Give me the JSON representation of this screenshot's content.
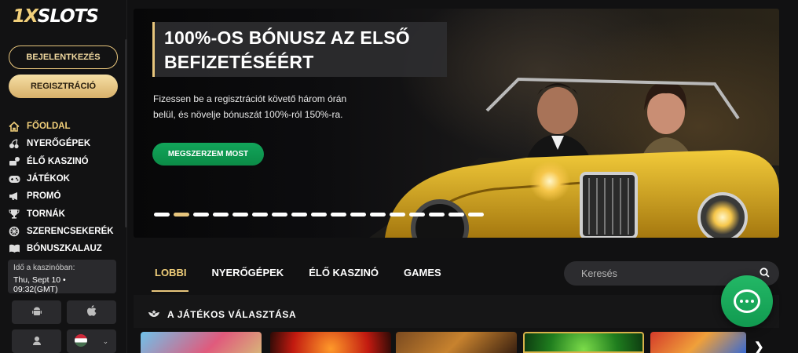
{
  "sidebar": {
    "logo": {
      "prefix": "1X",
      "suffix": "SLOTS"
    },
    "login_label": "BEJELENTKEZÉS",
    "register_label": "REGISZTRÁCIÓ",
    "items": [
      {
        "label": "FŐOLDAL",
        "icon": "home-icon"
      },
      {
        "label": "NYERŐGÉPEK",
        "icon": "cherries-icon"
      },
      {
        "label": "ÉLŐ KASZINÓ",
        "icon": "dealer-icon"
      },
      {
        "label": "JÁTÉKOK",
        "icon": "gamepad-icon"
      },
      {
        "label": "PROMÓ",
        "icon": "megaphone-icon"
      },
      {
        "label": "TORNÁK",
        "icon": "trophy-icon"
      },
      {
        "label": "SZERENCSEKERÉK",
        "icon": "wheel-icon"
      },
      {
        "label": "BÓNUSZKALAUZ",
        "icon": "book-icon"
      }
    ],
    "time_label": "Idő a kaszinóban:",
    "time_value": "Thu, Sept 10 • 09:32(GMT)",
    "apps": [
      "android-icon",
      "apple-icon",
      "support-icon",
      "hungary-flag-icon"
    ]
  },
  "banner": {
    "title_line1": "100%-OS BÓNUSZ AZ ELSŐ",
    "title_line2": "BEFIZETÉSÉÉRT",
    "subtitle_line1": "Fizessen be a regisztrációt követő három órán",
    "subtitle_line2": "belül, és növelje bónuszát 100%-ról 150%-ra.",
    "cta_label": "MEGSZERZEM MOST",
    "slide_count": 17,
    "active_slide": 2
  },
  "tabs": [
    {
      "label": "LOBBI",
      "active": true
    },
    {
      "label": "NYERŐGÉPEK",
      "active": false
    },
    {
      "label": "ÉLŐ KASZINÓ",
      "active": false
    },
    {
      "label": "GAMES",
      "active": false
    }
  ],
  "search": {
    "placeholder": "Keresés"
  },
  "section": {
    "title": "A JÁTÉKOS VÁLASZTÁSA"
  },
  "colors": {
    "accent": "#e7c57c",
    "green": "#12a55a",
    "background": "#111112"
  }
}
